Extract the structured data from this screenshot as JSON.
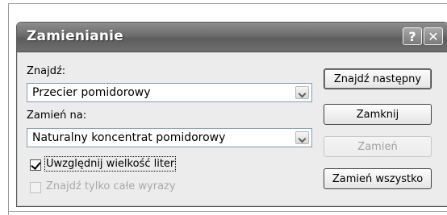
{
  "dialog": {
    "title": "Zamienianie",
    "help_symbol": "?",
    "close_symbol": "✕"
  },
  "find": {
    "label": "Znajdź:",
    "value": "Przecier pomidorowy"
  },
  "replace": {
    "label": "Zamień na:",
    "value": "Naturalny koncentrat pomidorowy"
  },
  "options": {
    "match_case_label": "Uwzględnij wielkość liter",
    "match_case_checked": true,
    "whole_words_label": "Znajdź tylko całe wyrazy",
    "whole_words_checked": false
  },
  "buttons": {
    "find_next": "Znajdź następny",
    "close": "Zamknij",
    "replace": "Zamień",
    "replace_all": "Zamień wszystko"
  }
}
